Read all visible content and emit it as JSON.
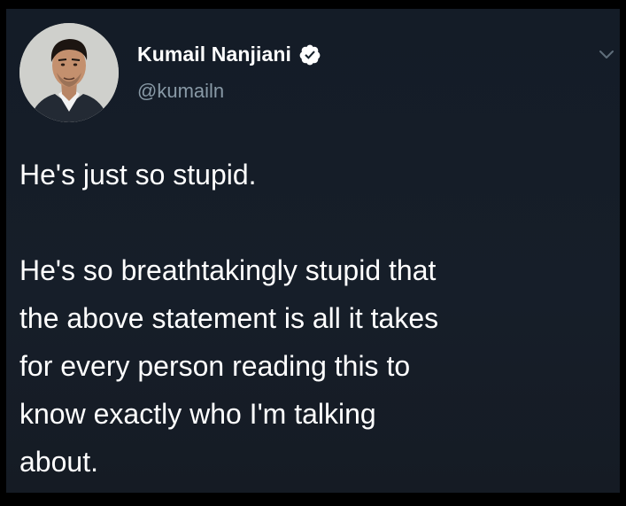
{
  "tweet": {
    "author": {
      "display_name": "Kumail Nanjiani",
      "handle": "@kumailn",
      "verified": true,
      "avatar_icon": "profile-photo"
    },
    "menu_icon": "chevron-down-icon",
    "text_lines": [
      "He's just so stupid.",
      "He's so breathtakingly stupid that",
      "the above statement is all it takes",
      "for every person reading this to",
      "know exactly who I'm talking",
      "about."
    ]
  },
  "colors": {
    "background": "#15202b",
    "text_primary": "#ffffff",
    "text_secondary": "#8899a6",
    "verified_badge": "#ffffff"
  }
}
